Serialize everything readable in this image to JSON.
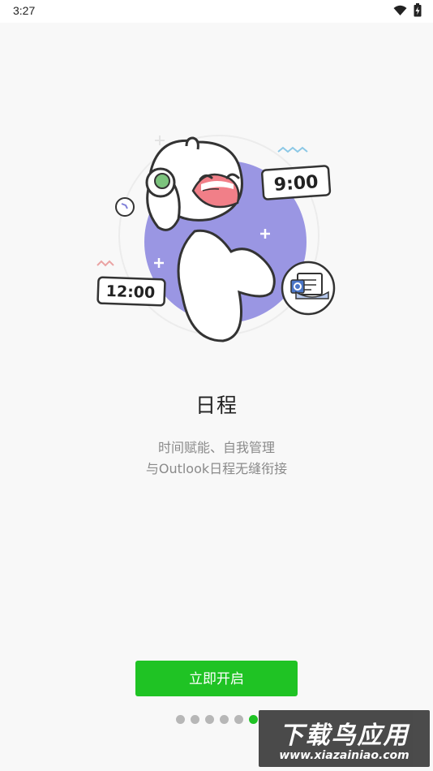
{
  "status_bar": {
    "time": "3:27",
    "icons": [
      "wifi-icon",
      "battery-charging-icon"
    ]
  },
  "illustration": {
    "time_badge_1": "9:00",
    "time_badge_2": "12:00"
  },
  "title": "日程",
  "subtitle": {
    "line1": "时间赋能、自我管理",
    "line2": "与Outlook日程无缝衔接"
  },
  "start_button": {
    "label": "立即开启"
  },
  "pager": {
    "count": 6,
    "active_index": 5
  },
  "watermark": {
    "line1": "下载鸟应用",
    "line2": "www.xiazainiao.com"
  },
  "colors": {
    "accent": "#1fc324",
    "purple": "#9a96e3",
    "dot_inactive": "#b7b7b7"
  }
}
